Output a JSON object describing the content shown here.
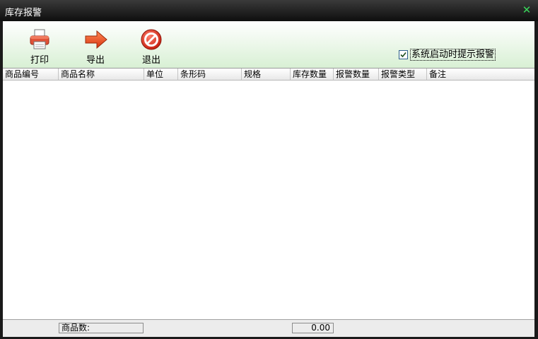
{
  "window": {
    "title": "库存报警"
  },
  "toolbar": {
    "print_label": "打印",
    "export_label": "导出",
    "exit_label": "退出",
    "alert_on_startup_label": "系统启动时提示报警",
    "alert_on_startup_checked": true
  },
  "table": {
    "columns": [
      "商品编号",
      "商品名称",
      "单位",
      "条形码",
      "规格",
      "库存数量",
      "报警数量",
      "报警类型",
      "备注"
    ],
    "rows": []
  },
  "status": {
    "product_count_label": "商品数:",
    "total_value": "0.00"
  },
  "colors": {
    "close_icon": "#39d65a",
    "toolbar_tint": "#d8f0d4"
  }
}
